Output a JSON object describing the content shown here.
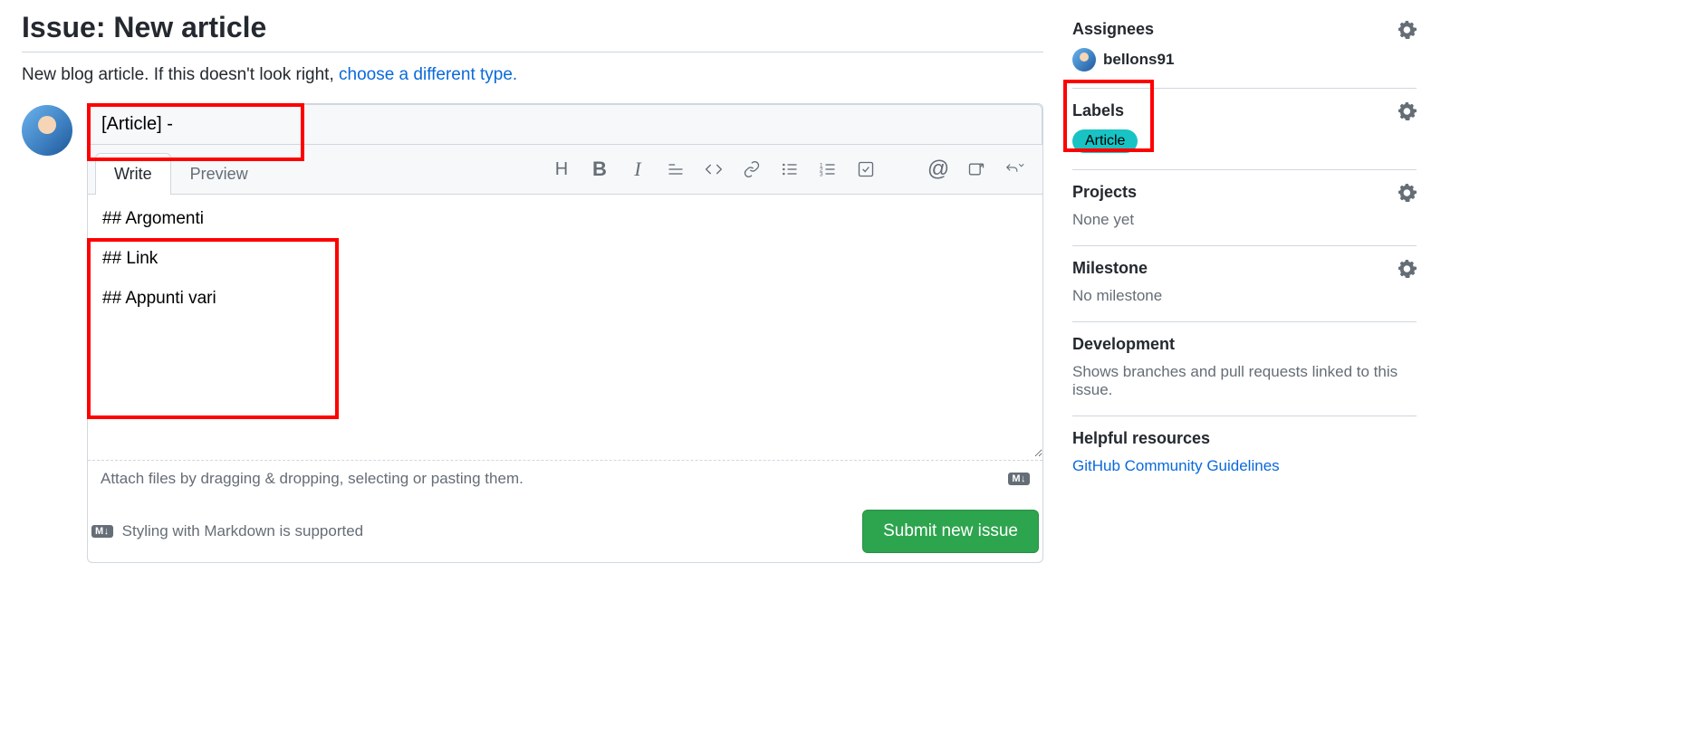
{
  "header": {
    "title": "Issue: New article",
    "subtitle_prefix": "New blog article. If this doesn't look right, ",
    "subtitle_link": "choose a different type."
  },
  "composer": {
    "title_value": "[Article] -",
    "tabs": {
      "write": "Write",
      "preview": "Preview"
    },
    "body_value": "## Argomenti\n\n## Link\n\n## Appunti vari",
    "attach_hint": "Attach files by dragging & dropping, selecting or pasting them.",
    "markdown_hint": "Styling with Markdown is supported",
    "submit_label": "Submit new issue",
    "md_badge": "M↓"
  },
  "toolbar": {
    "heading": "H",
    "bold": "B",
    "italic": "I",
    "at": "@"
  },
  "sidebar": {
    "assignees": {
      "title": "Assignees",
      "user": "bellons91"
    },
    "labels": {
      "title": "Labels",
      "chip": "Article"
    },
    "projects": {
      "title": "Projects",
      "value": "None yet"
    },
    "milestone": {
      "title": "Milestone",
      "value": "No milestone"
    },
    "development": {
      "title": "Development",
      "value": "Shows branches and pull requests linked to this issue."
    },
    "helpful": {
      "title": "Helpful resources",
      "link": "GitHub Community Guidelines"
    }
  }
}
